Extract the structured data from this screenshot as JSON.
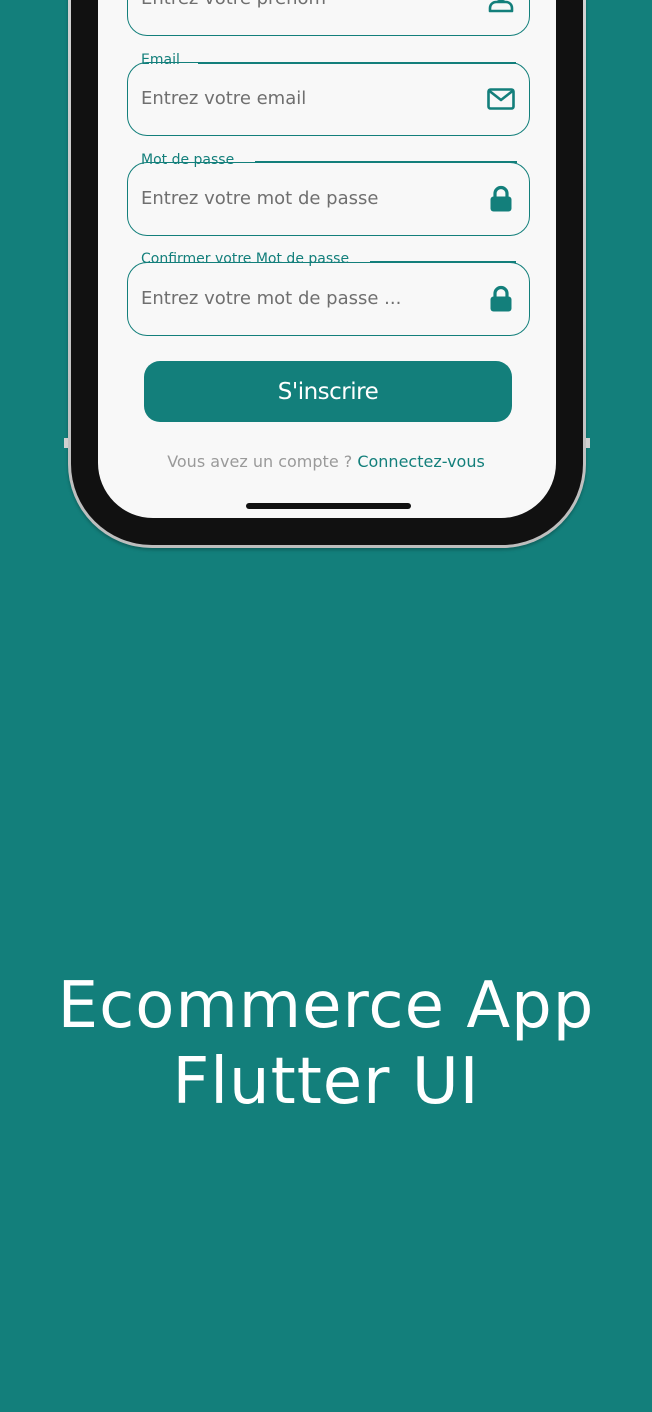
{
  "form": {
    "firstname": {
      "placeholder": "Entrez votre prénom"
    },
    "email": {
      "label": "Email",
      "placeholder": "Entrez votre email"
    },
    "password": {
      "label": "Mot de passe",
      "placeholder": "Entrez votre mot de passe"
    },
    "confirm": {
      "label": "Confirmer votre Mot de passe",
      "placeholder": "Entrez votre mot de passe ..."
    }
  },
  "submit_label": "S'inscrire",
  "signin": {
    "question": "Vous avez un compte ?",
    "link": "Connectez-vous"
  },
  "headline": {
    "line1": "Ecommerce App",
    "line2": "Flutter UI"
  },
  "colors": {
    "brand": "#137f7b",
    "screen": "#f8f8f8",
    "muted_text": "#9a9a9a"
  },
  "icons": [
    "user-icon",
    "mail-icon",
    "lock-icon",
    "lock-icon"
  ]
}
